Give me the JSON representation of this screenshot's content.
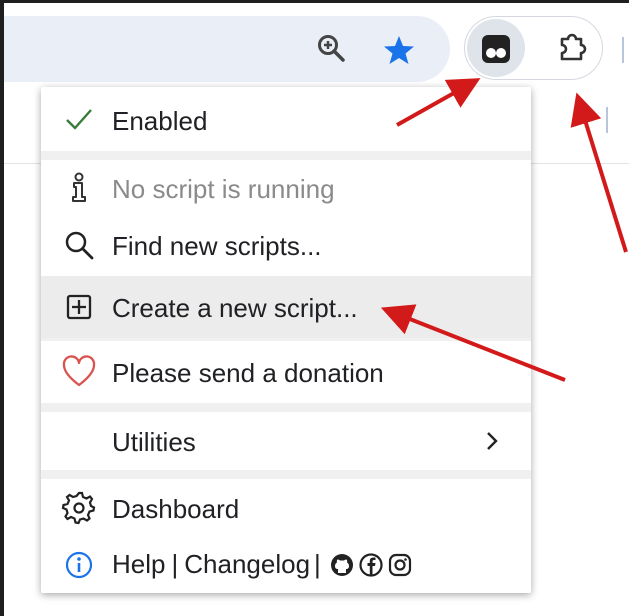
{
  "colors": {
    "accent": "#1a73e8",
    "check": "#3a7d3a",
    "heart": "#d9534f",
    "info": "#1a73e8",
    "annotation_arrow": "#d31a1a"
  },
  "toolbar": {
    "icons": [
      "zoom-icon",
      "bookmark-star-icon",
      "tampermonkey-icon",
      "extensions-puzzle-icon"
    ]
  },
  "menu": {
    "enabled": {
      "label": "Enabled",
      "icon": "checkmark-icon"
    },
    "no_script": {
      "label": "No script is running",
      "icon": "script-info-icon"
    },
    "find": {
      "label": "Find new scripts...",
      "icon": "search-icon"
    },
    "create": {
      "label": "Create a new script...",
      "icon": "plus-box-icon"
    },
    "donate": {
      "label": "Please send a donation",
      "icon": "heart-icon"
    },
    "utilities": {
      "label": "Utilities",
      "icon": "chevron-right-icon"
    },
    "dashboard": {
      "label": "Dashboard",
      "icon": "gear-icon"
    },
    "help": {
      "help_label": "Help",
      "sep1": "|",
      "changelog_label": "Changelog",
      "sep2": "|",
      "icon": "info-icon",
      "social_icons": [
        "github-icon",
        "facebook-icon",
        "instagram-icon"
      ]
    }
  }
}
